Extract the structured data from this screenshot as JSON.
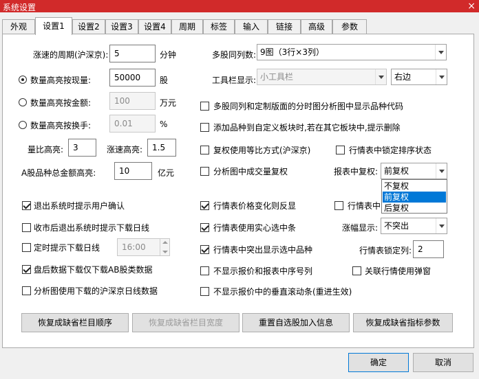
{
  "window": {
    "title": "系统设置",
    "close": "×"
  },
  "tabs": [
    "外观",
    "设置1",
    "设置2",
    "设置3",
    "设置4",
    "周期",
    "标签",
    "输入",
    "链接",
    "高级",
    "参数"
  ],
  "active_tab": "设置1",
  "left": {
    "rise_period_label": "涨速的周期(沪深京):",
    "rise_period_value": "5",
    "rise_period_unit": "分钟",
    "hl_volume_label": "数量高亮按现量:",
    "hl_volume_value": "50000",
    "hl_volume_unit": "股",
    "hl_amount_label": "数量高亮按金额:",
    "hl_amount_value": "100",
    "hl_amount_unit": "万元",
    "hl_turnover_label": "数量高亮按换手:",
    "hl_turnover_value": "0.01",
    "hl_turnover_unit": "%",
    "ratio_label": "量比高亮:",
    "ratio_value": "3",
    "speed_label": "涨速高亮:",
    "speed_value": "1.5",
    "a_amount_label": "A股品种总金额高亮:",
    "a_amount_value": "10",
    "a_amount_unit": "亿元"
  },
  "right": {
    "multi_cols_label": "多股同列数:",
    "multi_cols_value": "9图（3行×3列）",
    "toolbar_label": "工具栏显示:",
    "toolbar_value": "小工具栏",
    "toolbar_pos": "右边",
    "cb_show_code": "多股同列和定制版面的分时图分析图中显示品种代码",
    "cb_add_prompt": "添加品种到自定义板块时,若在其它板块中,提示删除",
    "cb_adjust_ratio": "复权使用等比方式(沪深京)",
    "cb_lock_sort": "行情表中锁定排序状态",
    "cb_volume_adjust": "分析图中成交量复权",
    "report_adjust_label": "报表中复权:",
    "report_adjust_value": "前复权",
    "dropdown_options": [
      "不复权",
      "前复权",
      "后复权"
    ]
  },
  "lower_left": {
    "cb_exit_confirm": "退出系统时提示用户确认",
    "cb_close_download": "收市后退出系统时提示下载日线",
    "cb_timed_download": "定时提示下载日线",
    "timed_value": "16:00",
    "cb_after_close": "盘后数据下载仅下载AB股类数据",
    "cb_use_downloaded": "分析图使用下载的沪深京日线数据"
  },
  "lower_right": {
    "cb_price_flip": "行情表价格变化则反显",
    "cb_hidden_partial": "行情表中",
    "cb_solid_select": "行情表使用实心选中条",
    "change_label": "涨幅显示:",
    "change_value": "不突出",
    "cb_highlight_row": "行情表中突出显示选中品种",
    "lock_cols_label": "行情表锁定列:",
    "lock_cols_value": "2",
    "cb_no_quote_no": "不显示报价和报表中序号列",
    "cb_popup": "关联行情使用弹窗",
    "cb_no_scroll": "不显示报价中的垂直滚动条(重进生效)"
  },
  "buttons": {
    "restore_order": "恢复成缺省栏目顺序",
    "restore_width": "恢复成缺省栏目宽度",
    "reset_self": "重置自选股加入信息",
    "restore_index": "恢复成缺省指标参数",
    "ok": "确定",
    "cancel": "取消"
  }
}
